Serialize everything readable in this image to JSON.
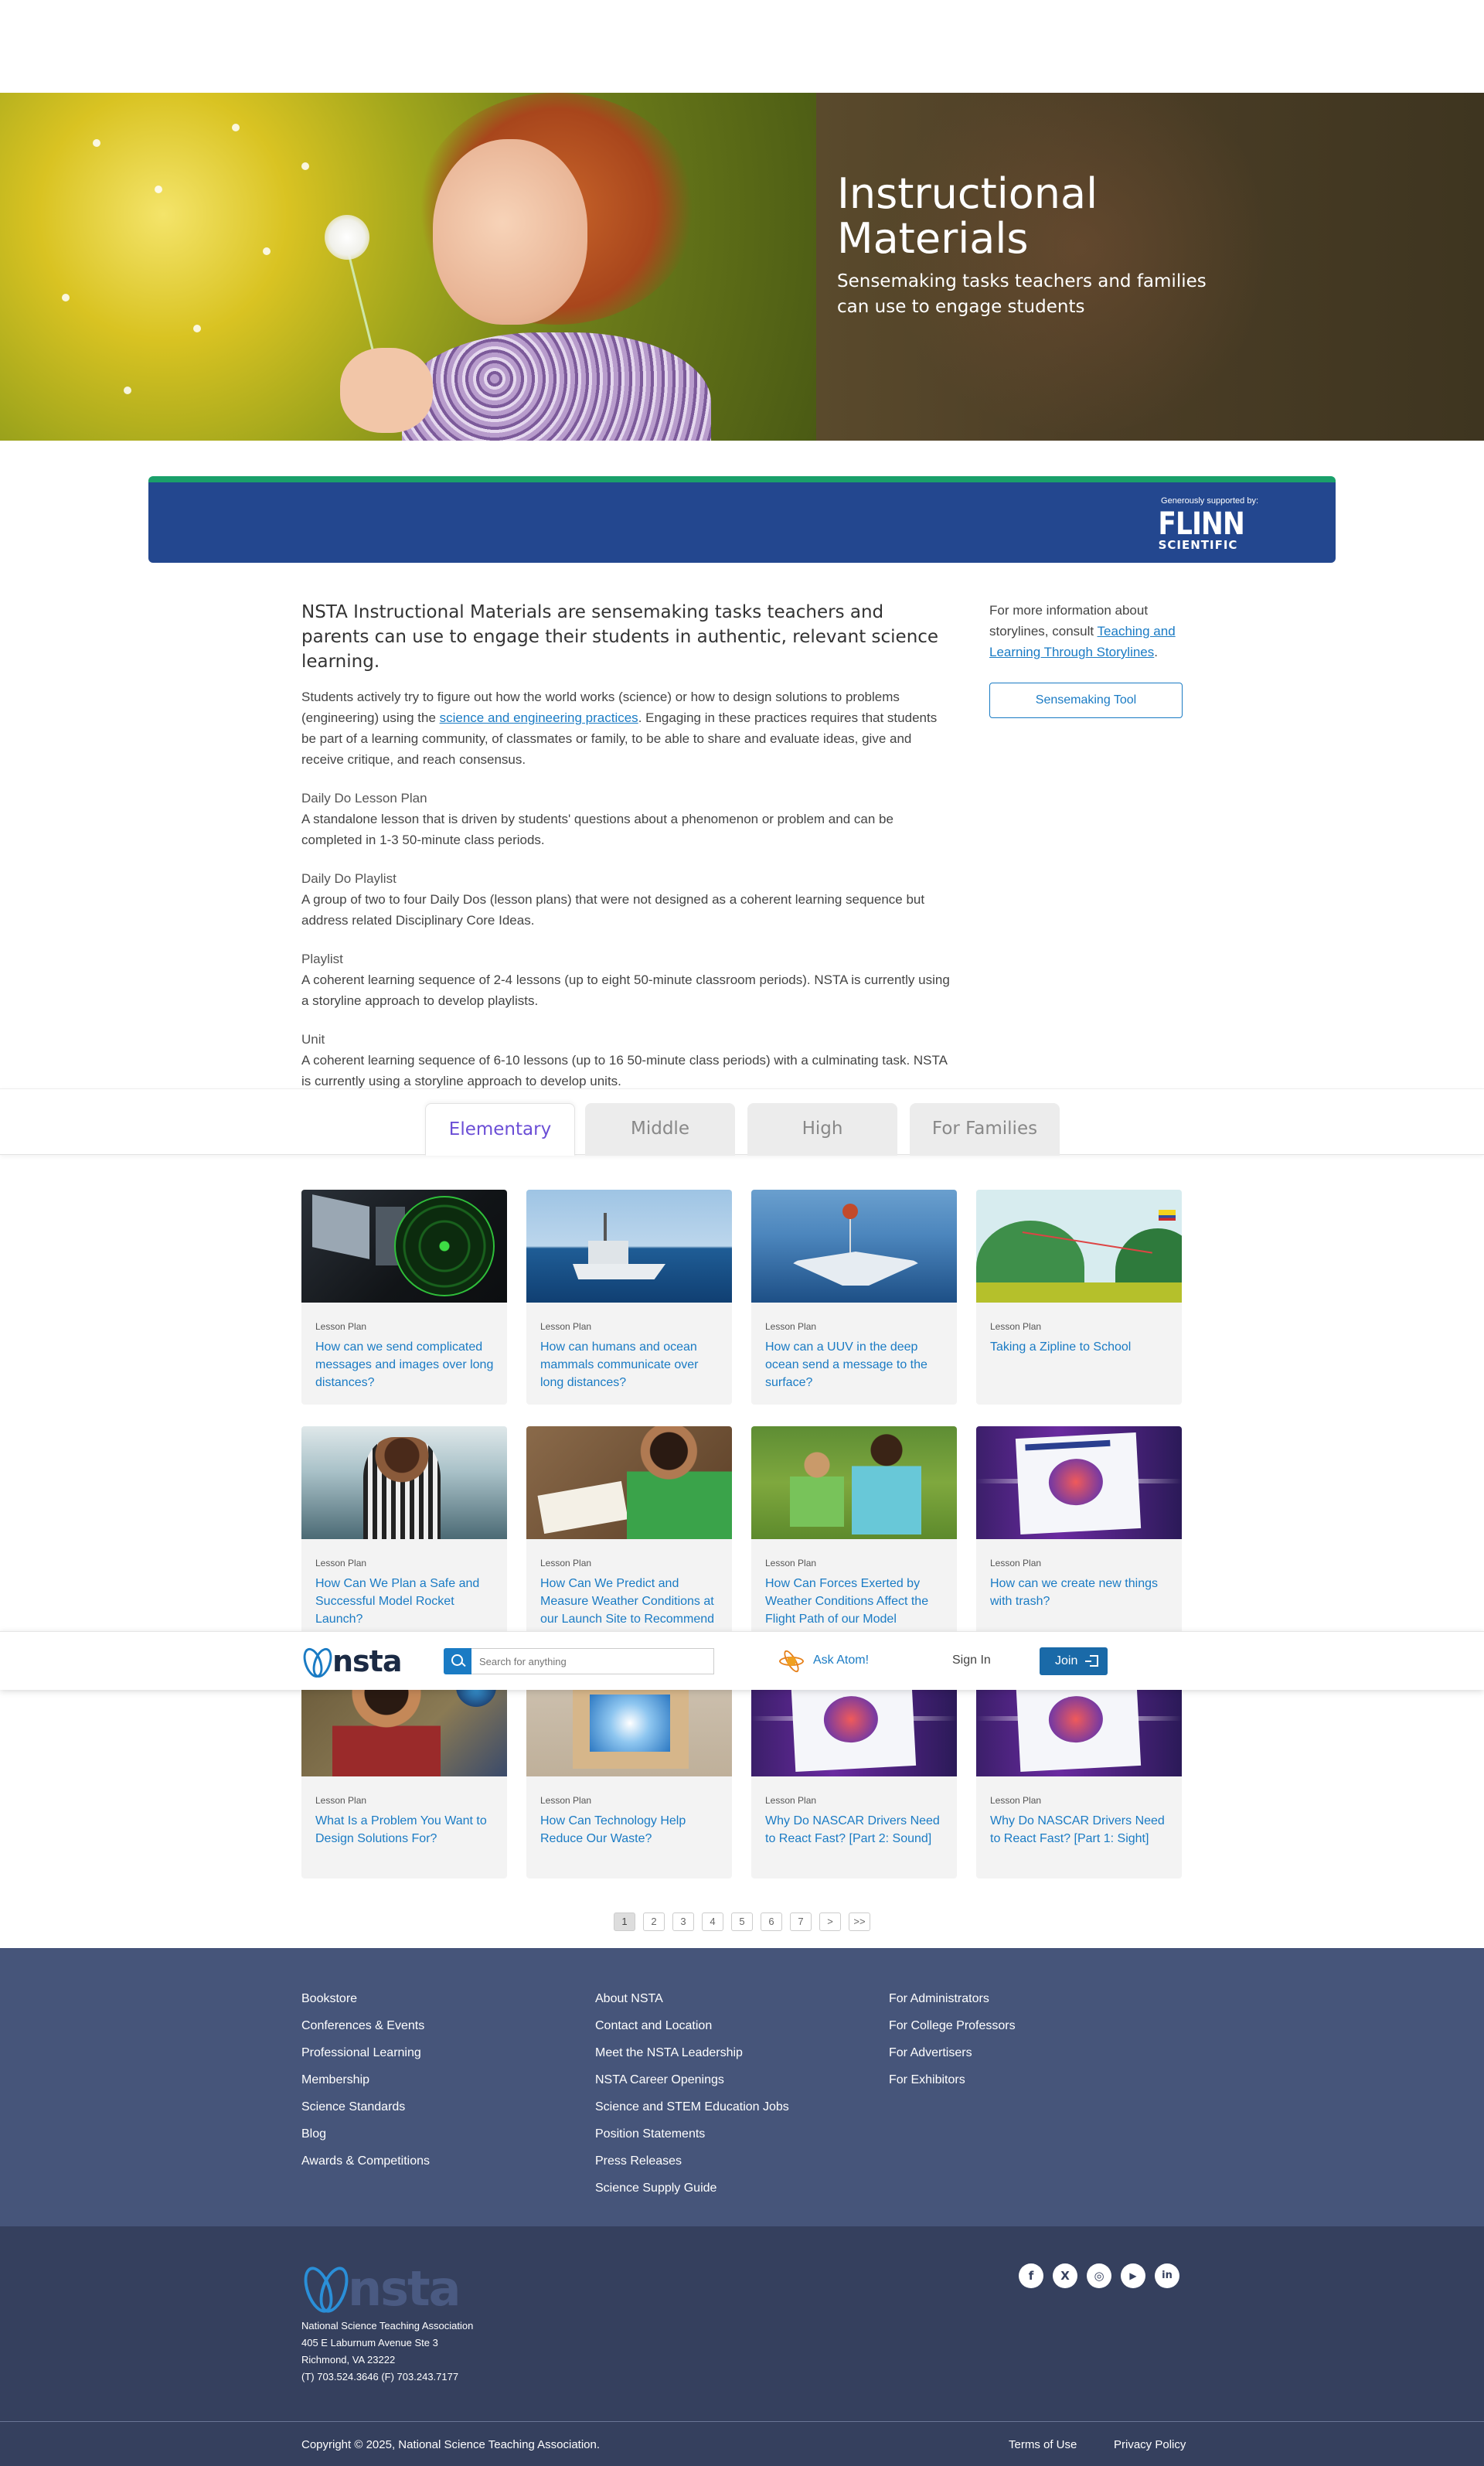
{
  "hero": {
    "title": "Instructional Materials",
    "subtitle": "Sensemaking tasks teachers and families can use to engage students"
  },
  "sponsor": {
    "label": "Generously supported by:",
    "logo_word": "FLINN",
    "logo_sub": "SCIENTIFIC",
    "colors": {
      "banner": "#23478f",
      "stripe": "#1aa06a"
    }
  },
  "intro": {
    "lead": "NSTA Instructional Materials are sensemaking tasks teachers and parents can use to engage their students in authentic, relevant science learning.",
    "p1_before": "Students actively try to figure out how the world works (science) or how to design solutions to problems (engineering) using the ",
    "p1_link": "science and engineering practices",
    "p1_after": ". Engaging in these practices requires that students be part of a learning community, of classmates or family, to be able to share and evaluate ideas, give and receive critique, and reach consensus.",
    "definitions": [
      {
        "term": "Daily Do Lesson Plan",
        "desc": "A standalone lesson that is driven by students' questions about a phenomenon or problem and can be completed in 1-3 50-minute class periods."
      },
      {
        "term": "Daily Do Playlist",
        "desc": "A group of two to four Daily Dos (lesson plans) that were not designed as a coherent learning sequence but address related Disciplinary Core Ideas."
      },
      {
        "term": "Playlist",
        "desc": "A coherent learning sequence of 2-4 lessons (up to eight 50-minute classroom periods). NSTA is currently using a storyline approach to develop playlists."
      },
      {
        "term": "Unit",
        "desc": "A coherent learning sequence of 6-10 lessons (up to 16 50-minute class periods) with a culminating task. NSTA is currently using a storyline approach to develop units."
      }
    ]
  },
  "aside": {
    "text_before": "For more information about storylines, consult ",
    "link": "Teaching and Learning Through Storylines",
    "text_after": ".",
    "button": "Sensemaking Tool"
  },
  "tabs": [
    "Elementary",
    "Middle",
    "High",
    "For Families"
  ],
  "active_tab": "Elementary",
  "cards": [
    {
      "type": "Lesson Plan",
      "title": "How can we send complicated messages and images over long distances?",
      "thumb": "radar-screen"
    },
    {
      "type": "Lesson Plan",
      "title": "How can humans and ocean mammals communicate over long distances?",
      "thumb": "ship-at-sea"
    },
    {
      "type": "Lesson Plan",
      "title": "How can a UUV in the deep ocean send a message to the surface?",
      "thumb": "underwater-vehicle"
    },
    {
      "type": "Lesson Plan",
      "title": "Taking a Zipline to School",
      "thumb": "zipline-illustration"
    },
    {
      "type": "Lesson Plan",
      "title": "How Can We Plan a Safe and Successful Model Rocket Launch?",
      "thumb": "classroom-girl"
    },
    {
      "type": "Lesson Plan",
      "title": "How Can We Predict and Measure Weather Conditions at our Launch Site to Recommend a Safe Launch",
      "thumb": "classroom-boy"
    },
    {
      "type": "Lesson Plan",
      "title": "How Can Forces Exerted by Weather Conditions Affect the Flight Path of our Model Rocket?",
      "thumb": "kids-on-grass"
    },
    {
      "type": "Lesson Plan",
      "title": "How can we create new things with trash?",
      "thumb": "magazine-page"
    },
    {
      "type": "Lesson Plan",
      "title": "What Is a Problem You Want to Design Solutions For?",
      "thumb": "boy-thinking"
    },
    {
      "type": "Lesson Plan",
      "title": "How Can Technology Help Reduce Our Waste?",
      "thumb": "open-box"
    },
    {
      "type": "Lesson Plan",
      "title": "Why Do NASCAR Drivers Need to React Fast? [Part 2: Sound]",
      "thumb": "magazine-page"
    },
    {
      "type": "Lesson Plan",
      "title": "Why Do NASCAR Drivers Need to React Fast? [Part 1: Sight]",
      "thumb": "magazine-page"
    }
  ],
  "header": {
    "logo": "nsta",
    "search_placeholder": "Search for anything",
    "ask": "Ask Atom!",
    "signin": "Sign In",
    "join": "Join"
  },
  "pagination": {
    "pages": [
      "1",
      "2",
      "3",
      "4",
      "5",
      "6",
      "7"
    ],
    "next": ">",
    "last": ">>",
    "current": "1"
  },
  "footer": {
    "col1": [
      "Bookstore",
      "Conferences & Events",
      "Professional Learning",
      "Membership",
      "Science Standards",
      "Blog",
      "Awards & Competitions"
    ],
    "col2": [
      "About NSTA",
      "Contact and Location",
      "Meet the NSTA Leadership",
      "NSTA Career Openings",
      "Science and STEM Education Jobs",
      "Position Statements",
      "Press Releases",
      "Science Supply Guide"
    ],
    "col3": [
      "For Administrators",
      "For College Professors",
      "For Advertisers",
      "For Exhibitors"
    ],
    "logo": "nsta",
    "address": [
      "National Science Teaching Association",
      "405 E Laburnum Avenue Ste 3",
      "Richmond, VA 23222",
      "(T) 703.524.3646 (F) 703.243.7177"
    ],
    "social": [
      {
        "icon": "facebook-icon",
        "glyph": "f"
      },
      {
        "icon": "x-icon",
        "glyph": "X"
      },
      {
        "icon": "instagram-icon",
        "glyph": "◎"
      },
      {
        "icon": "youtube-icon",
        "glyph": "▶"
      },
      {
        "icon": "linkedin-icon",
        "glyph": "in"
      }
    ],
    "copyright": "Copyright © 2025, National Science Teaching Association.",
    "terms": "Terms of Use",
    "privacy": "Privacy Policy"
  }
}
